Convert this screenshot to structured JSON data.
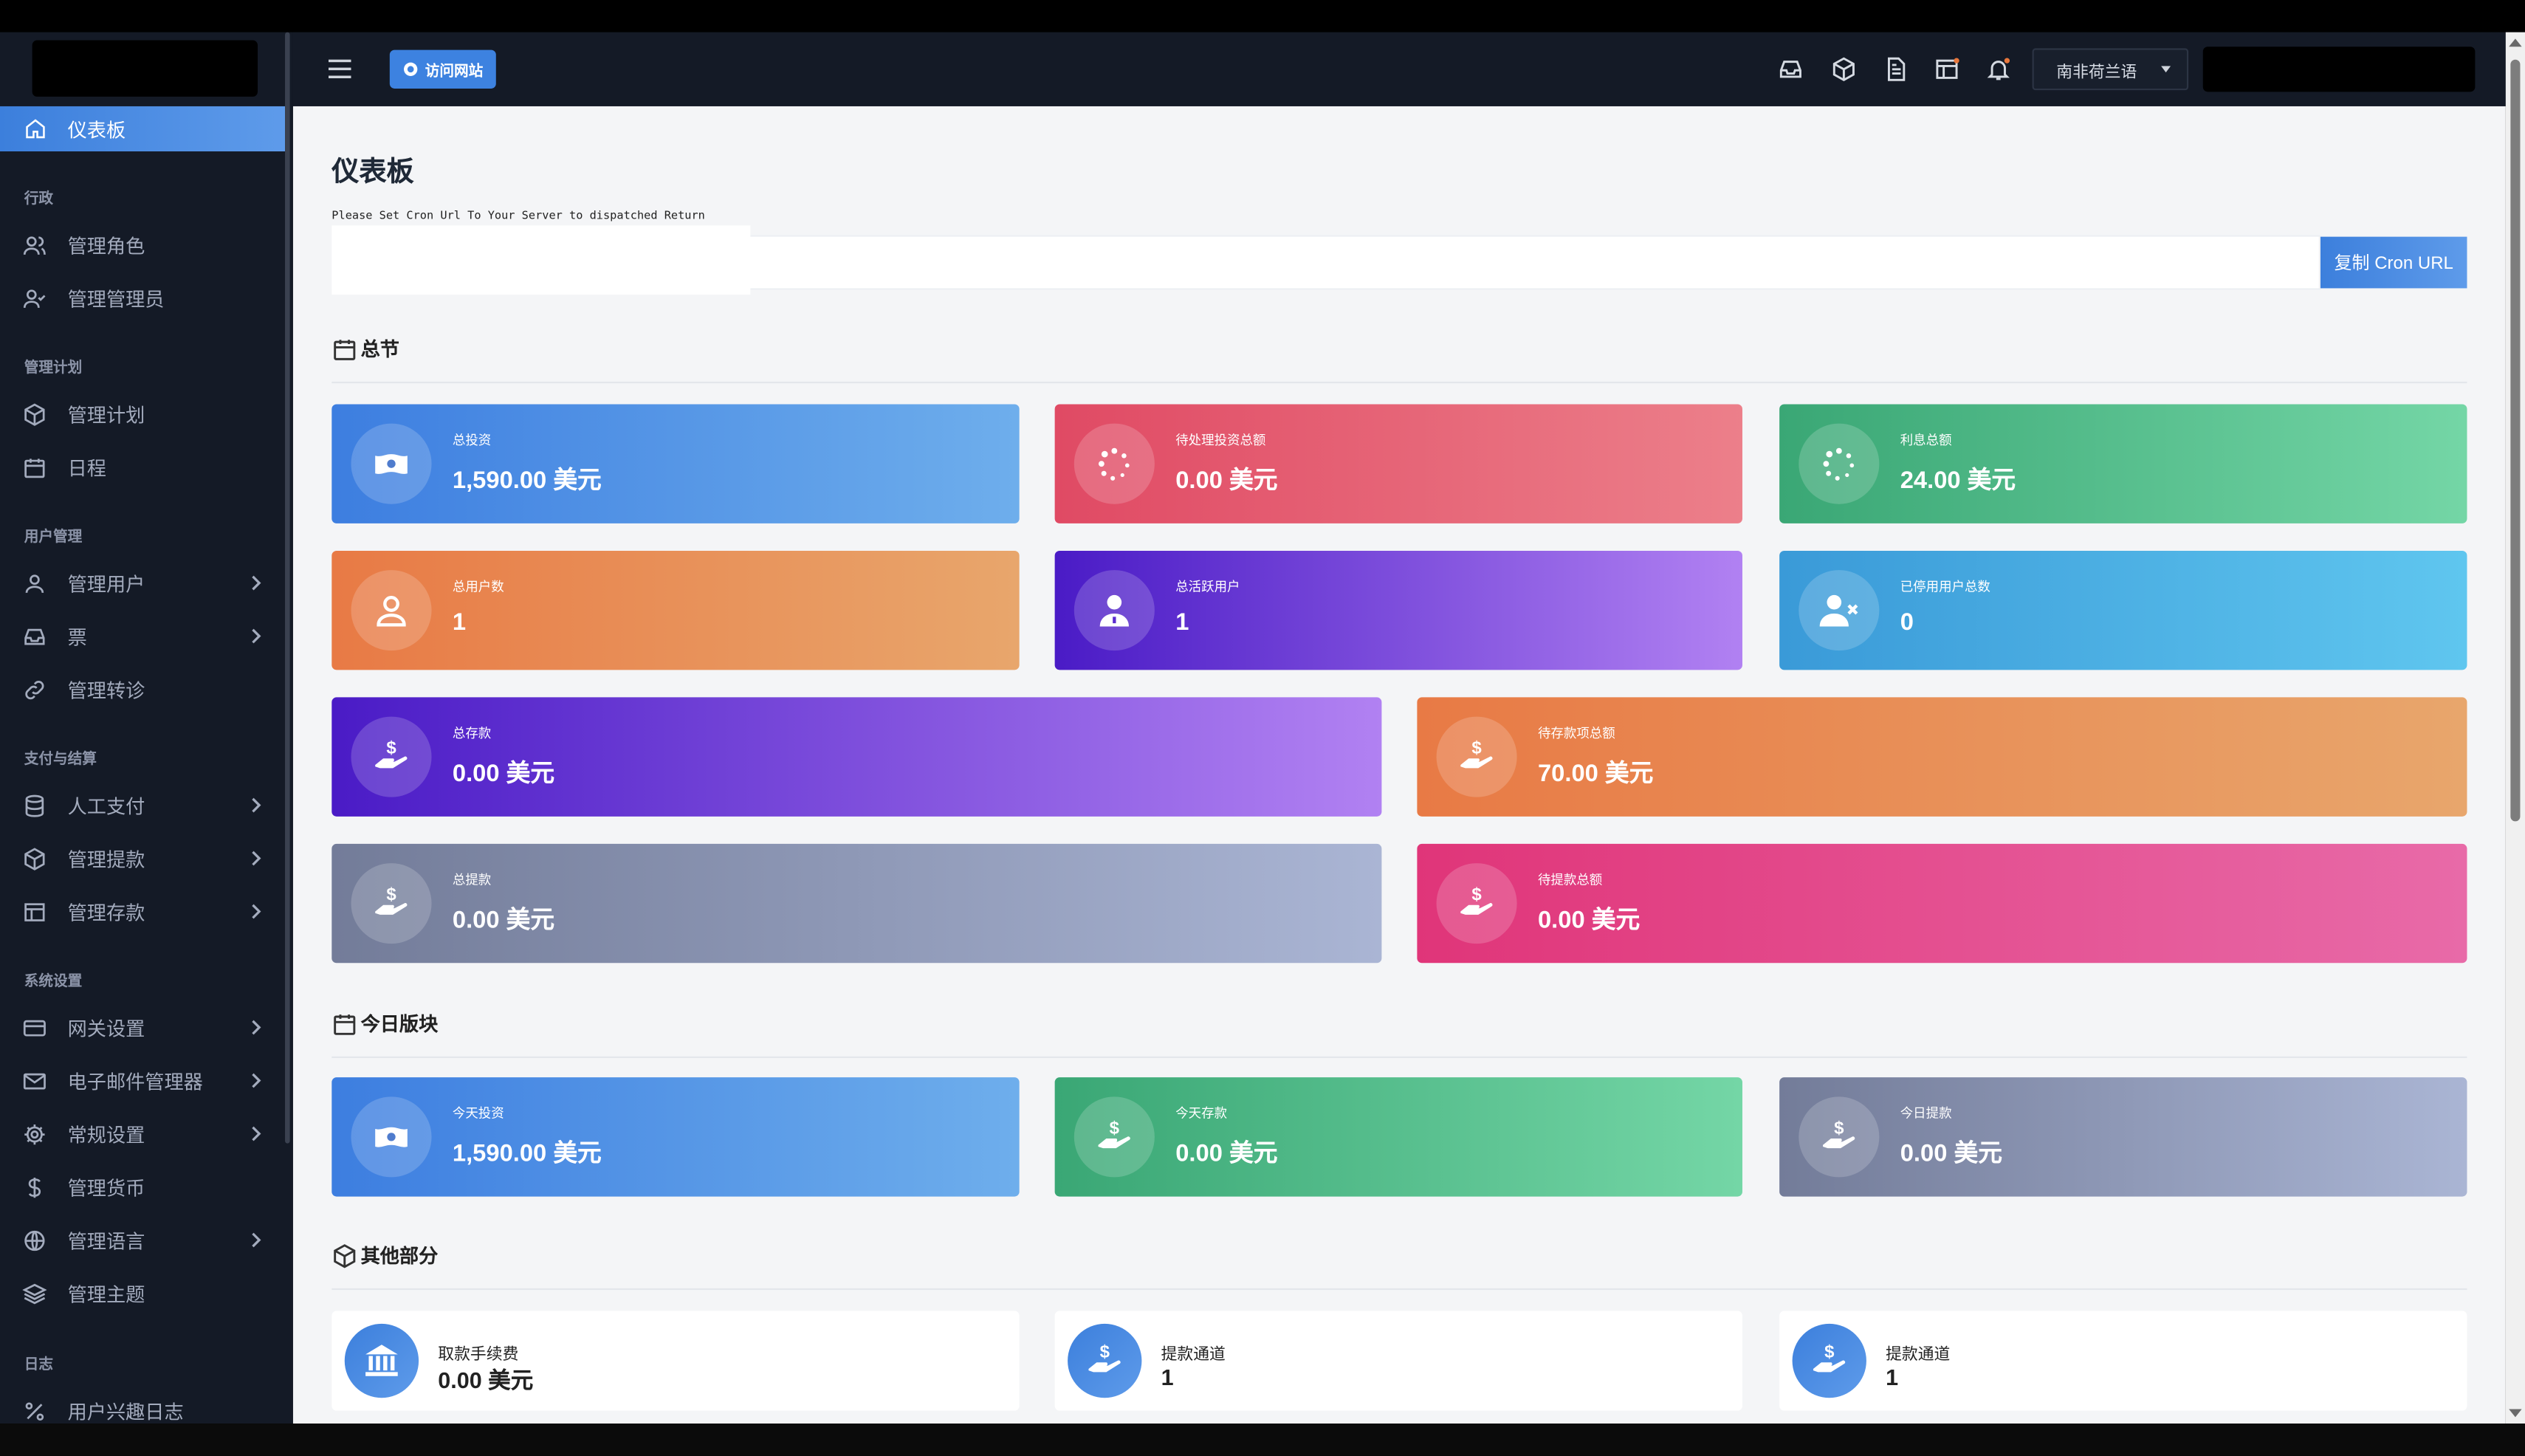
{
  "topbar": {
    "visit_label": "访问网站",
    "language": "南非荷兰语"
  },
  "sidebar": {
    "active": {
      "label": "仪表板",
      "icon": "home-icon"
    },
    "sections": [
      {
        "title": "行政",
        "items": [
          {
            "label": "管理角色",
            "icon": "users-icon",
            "chevron": false
          },
          {
            "label": "管理管理员",
            "icon": "user-check-icon",
            "chevron": false
          }
        ]
      },
      {
        "title": "管理计划",
        "items": [
          {
            "label": "管理计划",
            "icon": "box-icon",
            "chevron": false
          },
          {
            "label": "日程",
            "icon": "calendar-icon",
            "chevron": false
          }
        ]
      },
      {
        "title": "用户管理",
        "items": [
          {
            "label": "管理用户",
            "icon": "user-icon",
            "chevron": true
          },
          {
            "label": "票",
            "icon": "inbox-icon",
            "chevron": true
          },
          {
            "label": "管理转诊",
            "icon": "link-icon",
            "chevron": false
          }
        ]
      },
      {
        "title": "支付与结算",
        "items": [
          {
            "label": "人工支付",
            "icon": "database-icon",
            "chevron": true
          },
          {
            "label": "管理提款",
            "icon": "box-icon",
            "chevron": true
          },
          {
            "label": "管理存款",
            "icon": "table-icon",
            "chevron": true
          }
        ]
      },
      {
        "title": "系统设置",
        "items": [
          {
            "label": "网关设置",
            "icon": "credit-card-icon",
            "chevron": true
          },
          {
            "label": "电子邮件管理器",
            "icon": "mail-icon",
            "chevron": true
          },
          {
            "label": "常规设置",
            "icon": "gear-icon",
            "chevron": true
          },
          {
            "label": "管理货币",
            "icon": "dollar-icon",
            "chevron": false
          },
          {
            "label": "管理语言",
            "icon": "globe-icon",
            "chevron": true
          },
          {
            "label": "管理主题",
            "icon": "layers-icon",
            "chevron": false
          }
        ]
      },
      {
        "title": "日志",
        "items": [
          {
            "label": "用户兴趣日志",
            "icon": "percent-icon",
            "chevron": false
          }
        ]
      }
    ]
  },
  "page": {
    "title": "仪表板",
    "cron_message": "Please Set Cron Url To Your Server to dispatched Return",
    "cron_button": "复制 Cron URL"
  },
  "sections": {
    "summary": "总节",
    "today": "今日版块",
    "other": "其他部分"
  },
  "summary_cards": [
    {
      "label": "总投资",
      "value": "1,590.00 美元",
      "icon": "money-icon",
      "gradient": [
        "#3d7ee0",
        "#6eaeec"
      ]
    },
    {
      "label": "待处理投资总额",
      "value": "0.00 美元",
      "icon": "spinner-icon",
      "gradient": [
        "#e04a64",
        "#ec7f8a"
      ]
    },
    {
      "label": "利息总额",
      "value": "24.00 美元",
      "icon": "spinner-icon",
      "gradient": [
        "#3aa775",
        "#74d6a6"
      ]
    },
    {
      "label": "总用户数",
      "value": "1",
      "icon": "user-icon",
      "gradient": [
        "#e87a45",
        "#e8a66c"
      ]
    },
    {
      "label": "总活跃用户",
      "value": "1",
      "icon": "user-badge-icon",
      "gradient": [
        "#4a1bc6",
        "#b181f2"
      ]
    },
    {
      "label": "已停用用户总数",
      "value": "0",
      "icon": "user-x-icon",
      "gradient": [
        "#3a9ad8",
        "#5fc6ef"
      ]
    },
    {
      "label": "总存款",
      "value": "0.00 美元",
      "icon": "hand-dollar-icon",
      "gradient": [
        "#4a1bc6",
        "#b181f2"
      ]
    },
    {
      "label": "待存款项总额",
      "value": "70.00 美元",
      "icon": "hand-dollar-icon",
      "gradient": [
        "#e87a45",
        "#e8a66c"
      ]
    },
    {
      "label": "总提款",
      "value": "0.00 美元",
      "icon": "hand-dollar-icon",
      "gradient": [
        "#737c99",
        "#aab5d4"
      ]
    },
    {
      "label": "待提款总额",
      "value": "0.00 美元",
      "icon": "hand-dollar-icon",
      "gradient": [
        "#e03579",
        "#e86aa8"
      ]
    }
  ],
  "today_cards": [
    {
      "label": "今天投资",
      "value": "1,590.00 美元",
      "icon": "money-icon",
      "gradient": [
        "#3d7ee0",
        "#6eaeec"
      ]
    },
    {
      "label": "今天存款",
      "value": "0.00 美元",
      "icon": "hand-dollar-icon",
      "gradient": [
        "#3aa775",
        "#74d6a6"
      ]
    },
    {
      "label": "今日提款",
      "value": "0.00 美元",
      "icon": "hand-dollar-icon",
      "gradient": [
        "#737c99",
        "#aab5d4"
      ]
    }
  ],
  "other_cards": [
    {
      "label": "取款手续费",
      "value": "0.00 美元",
      "icon": "bank-icon"
    },
    {
      "label": "提款通道",
      "value": "1",
      "icon": "hand-dollar-icon"
    },
    {
      "label": "提款通道",
      "value": "1",
      "icon": "hand-dollar-icon"
    }
  ]
}
